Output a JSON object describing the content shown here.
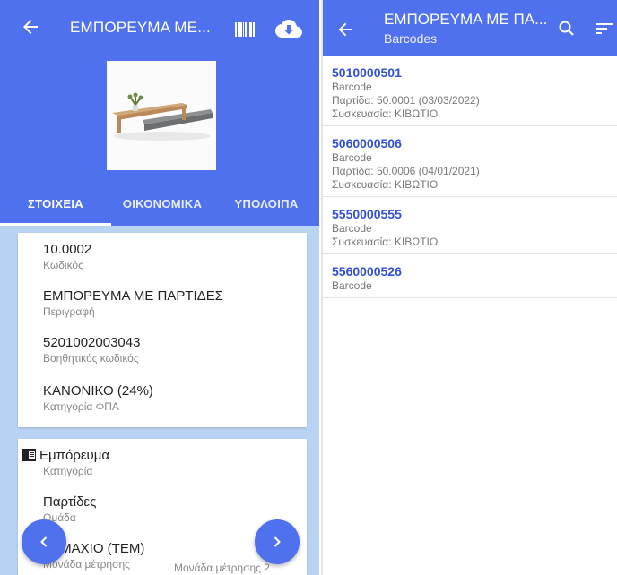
{
  "left": {
    "title": "ΕΜΠΟΡΕΥΜΑ ΜΕ...",
    "tabs": [
      "ΣΤΟΙΧΕΙΑ",
      "ΟΙΚΟΝΟΜΙΚΑ",
      "ΥΠΟΛΟΙΠΑ"
    ],
    "active_tab": "ΣΤΟΙΧΕΙΑ",
    "details": [
      {
        "value": "10.0002",
        "label": "Κωδικός"
      },
      {
        "value": "ΕΜΠΟΡΕΥΜΑ ΜΕ ΠΑΡΤΙΔΕΣ",
        "label": "Περιγραφή"
      },
      {
        "value": "5201002003043",
        "label": "Βοηθητικός κωδικός"
      },
      {
        "value": "ΚΑΝΟΝΙΚΟ (24%)",
        "label": "Κατηγορία ΦΠΑ"
      }
    ],
    "classification": {
      "category": {
        "value": "Εμπόρευμα",
        "label": "Κατηγορία"
      },
      "group": {
        "value": "Παρτίδες",
        "label": "Ομάδα"
      },
      "unit": {
        "value": "ΤΕΜΑΧΙΟ (ΤΕΜ)",
        "label": "Μονάδα μέτρησης"
      },
      "unit2_label": "Μονάδα μέτρησης 2"
    },
    "colors": {
      "primary": "#4f71ee",
      "background": "#b9d3f2"
    }
  },
  "right": {
    "title": "ΕΜΠΟΡΕΥΜΑ ΜΕ ΠΑ...",
    "subtitle": "Barcodes",
    "items": [
      {
        "code": "5010000501",
        "type": "Barcode",
        "batch": "Παρτίδα:  50.0001 (03/03/2022)",
        "package": "Συσκευασία:  ΚΙΒΩΤΙΟ"
      },
      {
        "code": "5060000506",
        "type": "Barcode",
        "batch": "Παρτίδα:  50.0006 (04/01/2021)",
        "package": "Συσκευασία:  ΚΙΒΩΤΙΟ"
      },
      {
        "code": "5550000555",
        "type": "Barcode",
        "batch": "",
        "package": "Συσκευασία:  ΚΙΒΩΤΙΟ"
      },
      {
        "code": "5560000526",
        "type": "Barcode",
        "batch": "",
        "package": ""
      }
    ],
    "colors": {
      "code": "#3350d2"
    }
  }
}
